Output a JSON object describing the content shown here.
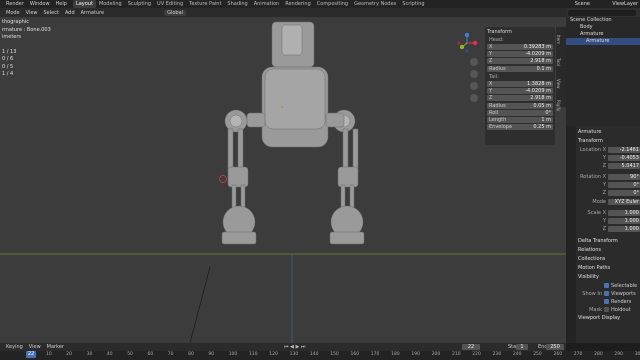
{
  "app": {
    "menus": [
      "Render",
      "Window",
      "Help"
    ],
    "workspaces": [
      "Layout",
      "Modeling",
      "Sculpting",
      "UV Editing",
      "Texture Paint",
      "Shading",
      "Animation",
      "Rendering",
      "Compositing",
      "Geometry Nodes",
      "Scripting"
    ],
    "active_workspace": "Layout",
    "scene": "Scene",
    "view_layer": "ViewLayer"
  },
  "viewport_header": {
    "menus": [
      "Mode",
      "View",
      "Select",
      "Add",
      "Armature"
    ],
    "orientation": "Global"
  },
  "overlay": {
    "lines": [
      "thographic",
      "rmature : Bone.003",
      "imeters",
      "",
      "1 / 13",
      "0 / 6",
      "0 / 5",
      "1 / 4"
    ]
  },
  "npanel": {
    "title": "Transform",
    "head_label": "Head:",
    "head": [
      {
        "k": "X",
        "v": "0.39283 m"
      },
      {
        "k": "Y",
        "v": "-4.0209 m"
      },
      {
        "k": "Z",
        "v": "2.918 m"
      }
    ],
    "radius_head": {
      "k": "Radius",
      "v": "0.1 m"
    },
    "tail_label": "Tail:",
    "tail": [
      {
        "k": "X",
        "v": "1.3828 m"
      },
      {
        "k": "Y",
        "v": "-4.0209 m"
      },
      {
        "k": "Z",
        "v": "2.918 m"
      }
    ],
    "radius_tail": {
      "k": "Radius",
      "v": "0.05 m"
    },
    "roll": {
      "k": "Roll",
      "v": "0°"
    },
    "length": {
      "k": "Length",
      "v": "1 m"
    },
    "envelope": {
      "k": "Envelope",
      "v": "0.25 m"
    },
    "tabs": [
      "Item",
      "Tool",
      "View",
      "Rigify"
    ]
  },
  "outliner": {
    "items": [
      "Scene Collection",
      "Body",
      "Armature",
      "Armature"
    ]
  },
  "properties": {
    "object": "Armature",
    "sections": {
      "transform": "Transform",
      "delta": "Delta Transform",
      "relations": "Relations",
      "collections": "Collections",
      "motion": "Motion Paths",
      "visibility": "Visibility",
      "viewport_display": "Viewport Display"
    },
    "location": [
      {
        "k": "Location X",
        "v": "-2.1461"
      },
      {
        "k": "Y",
        "v": "-0.4053"
      },
      {
        "k": "Z",
        "v": "5.0417"
      }
    ],
    "rotation": [
      {
        "k": "Rotation X",
        "v": "90°"
      },
      {
        "k": "Y",
        "v": "0°"
      },
      {
        "k": "Z",
        "v": "0°"
      }
    ],
    "mode": {
      "k": "Mode",
      "v": "XYZ Euler"
    },
    "scale": [
      {
        "k": "Scale X",
        "v": "1.000"
      },
      {
        "k": "Y",
        "v": "1.000"
      },
      {
        "k": "Z",
        "v": "1.000"
      }
    ],
    "selectable": "Selectable",
    "show_in": "Show In",
    "viewports": "Viewports",
    "renders": "Renders",
    "mask": "Mask",
    "holdout": "Holdout"
  },
  "timeline": {
    "menus": [
      "Keying",
      "View",
      "Marker"
    ],
    "current_frame": "22",
    "start_label": "Start",
    "start": "1",
    "end_label": "End",
    "end": "250",
    "ruler": [
      "22",
      "10",
      "20",
      "30",
      "40",
      "50",
      "60",
      "70",
      "80",
      "90",
      "100",
      "110",
      "120",
      "130",
      "140",
      "150",
      "160",
      "170",
      "180",
      "190",
      "200",
      "210",
      "220",
      "230",
      "240",
      "250",
      "260",
      "270",
      "280",
      "290",
      "300",
      "310"
    ]
  },
  "colors": {
    "accent": "#4772b3",
    "x_axis": "#e0324a",
    "y_axis": "#8ab82b",
    "z_axis": "#3f7fd6"
  }
}
